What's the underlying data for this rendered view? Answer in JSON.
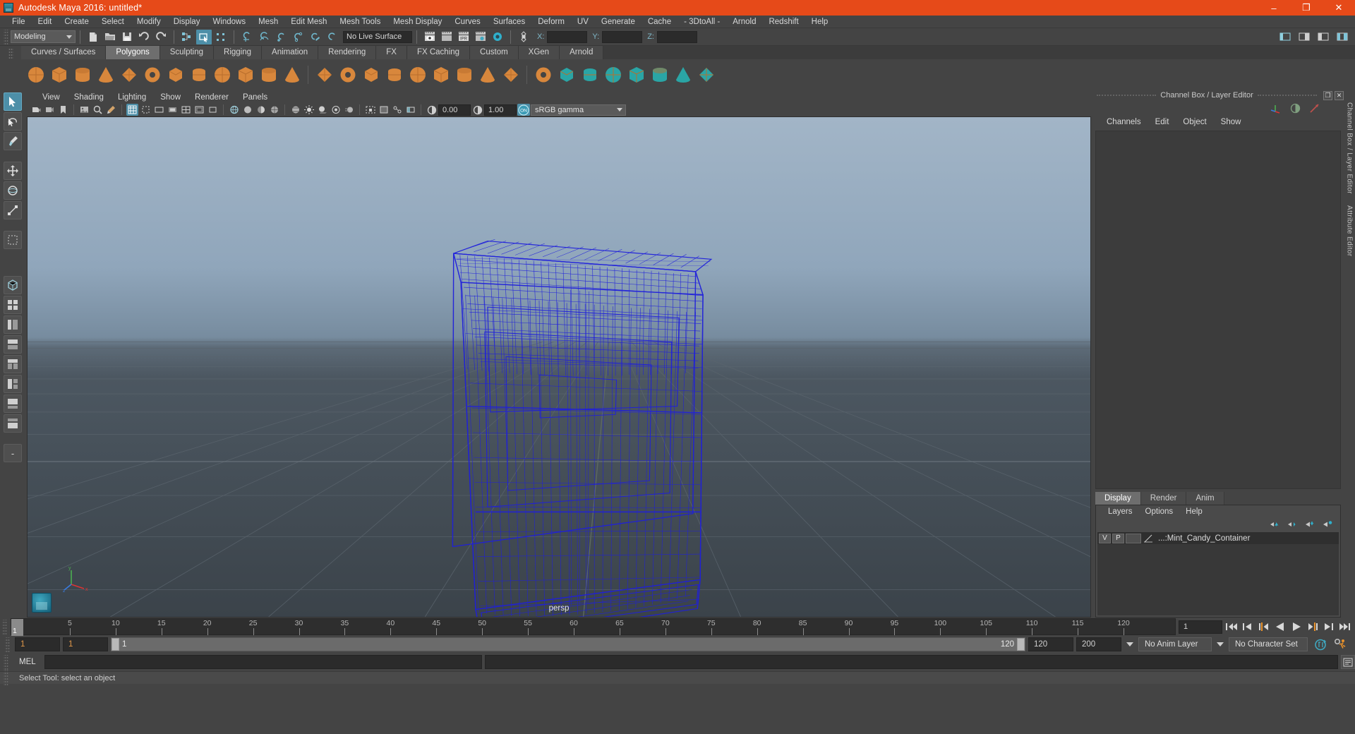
{
  "window": {
    "title": "Autodesk Maya 2016: untitled*",
    "icon": "maya-logo-icon",
    "minimize": "–",
    "maximize": "❐",
    "close": "✕",
    "titlebar_color": "#E64A19"
  },
  "menubar": {
    "items": [
      "File",
      "Edit",
      "Create",
      "Select",
      "Modify",
      "Display",
      "Windows",
      "Mesh",
      "Edit Mesh",
      "Mesh Tools",
      "Mesh Display",
      "Curves",
      "Surfaces",
      "Deform",
      "UV",
      "Generate",
      "Cache",
      "- 3DtoAll -",
      "Arnold",
      "Redshift",
      "Help"
    ]
  },
  "statusbar": {
    "mode_menu": "Modeling",
    "live_surface": "No Live Surface",
    "axis": {
      "x_label": "X:",
      "x_value": "",
      "y_label": "Y:",
      "y_value": "",
      "z_label": "Z:",
      "z_value": ""
    },
    "icons": [
      "new-scene-icon",
      "open-scene-icon",
      "save-scene-icon",
      "undo-icon",
      "redo-icon",
      "select-by-hierarchy-icon",
      "select-by-object-icon",
      "select-by-component-icon",
      "snap-to-grid-icon",
      "snap-to-curve-icon",
      "snap-to-point-icon",
      "snap-to-projected-center-icon",
      "snap-to-view-plane-icon",
      "make-live-icon",
      "render-current-frame-icon",
      "render-sequence-icon",
      "ipr-render-icon",
      "render-settings-icon",
      "hypershade-icon",
      "toggle-editors-icon"
    ]
  },
  "shelf": {
    "tabs": [
      "Curves / Surfaces",
      "Polygons",
      "Sculpting",
      "Rigging",
      "Animation",
      "Rendering",
      "FX",
      "FX Caching",
      "Custom",
      "XGen",
      "Arnold"
    ],
    "selected_tab": "Polygons",
    "icons": [
      "poly-sphere-icon",
      "poly-cube-icon",
      "poly-cylinder-icon",
      "poly-cone-icon",
      "poly-plane-icon",
      "poly-torus-icon",
      "poly-prism-icon",
      "poly-pyramid-icon",
      "poly-pipe-icon",
      "poly-helix-icon",
      "poly-soccer-ball-icon",
      "poly-platonic-icon",
      "poly-combine-icon",
      "poly-separate-icon",
      "poly-smooth-icon",
      "poly-extrude-icon",
      "poly-bevel-icon",
      "poly-bridge-icon",
      "poly-append-icon",
      "poly-wedge-icon",
      "poly-duplicate-icon",
      "poly-booleans-union-icon",
      "poly-booleans-difference-icon",
      "poly-booleans-intersection-icon",
      "poly-mirror-icon",
      "poly-reduce-icon",
      "poly-triangulate-icon",
      "poly-quadrangulate-icon",
      "poly-crease-icon"
    ]
  },
  "toolbox": {
    "items": [
      "select-tool",
      "lasso-select-tool",
      "paint-select-tool",
      "move-tool",
      "rotate-tool",
      "scale-tool",
      "last-tool",
      "show-manipulator-tool"
    ],
    "layout_icons": [
      "single-perspective-view",
      "four-view-layout",
      "persp-outliner-layout",
      "persp-graph-layout",
      "persp-hypershade-layout",
      "two-panes-stacked",
      "persp-uv-layout",
      "persp-relationship-layout",
      "more-layouts"
    ],
    "selected": "select-tool"
  },
  "viewport": {
    "menus": [
      "View",
      "Shading",
      "Lighting",
      "Show",
      "Renderer",
      "Panels"
    ],
    "camera_label": "persp",
    "toolbar": {
      "exposure_value": "0.00",
      "gamma_value": "1.00",
      "color_management_toggle": "ON",
      "view_transform": "sRGB gamma"
    },
    "axis_gizmo": {
      "y": "y",
      "x": "x",
      "z": "z"
    },
    "object_name": "Mint_Candy_Container",
    "wireframe_color": "#1b1bd8"
  },
  "right_dock": {
    "panel_title": "Channel Box / Layer Editor",
    "restore_btn": "❐",
    "close_btn": "✕",
    "menus": [
      "Channels",
      "Edit",
      "Object",
      "Show"
    ],
    "side_tabs": [
      "Channel Box / Layer Editor",
      "Attribute Editor"
    ],
    "header_icons": [
      "channel-box-icon",
      "attribute-editor-icon",
      "modeling-toolkit-icon"
    ],
    "layer_tabs": [
      "Display",
      "Render",
      "Anim"
    ],
    "selected_layer_tab": "Display",
    "layer_menus": [
      "Layers",
      "Options",
      "Help"
    ],
    "layer_toolbar_icons": [
      "move-layer-up-icon",
      "move-layer-down-icon",
      "new-layer-icon",
      "new-layer-from-selected-icon"
    ],
    "layers": [
      {
        "visibility": "V",
        "playback": "P",
        "color": "",
        "name": "...:Mint_Candy_Container"
      }
    ]
  },
  "timeline": {
    "ticks": [
      5,
      10,
      15,
      20,
      25,
      30,
      35,
      40,
      45,
      50,
      55,
      60,
      65,
      70,
      75,
      80,
      85,
      90,
      95,
      100,
      105,
      110,
      115,
      120
    ],
    "current_frame_marker": "1",
    "end_label": "120",
    "current_frame_field": "1",
    "playback_buttons": [
      "go-to-start-icon",
      "step-back-frame-icon",
      "step-back-key-icon",
      "play-backwards-icon",
      "play-forwards-icon",
      "step-forward-key-icon",
      "step-forward-frame-icon",
      "go-to-end-icon"
    ]
  },
  "range_slider": {
    "anim_start": "1",
    "range_start": "1",
    "slider_start_label": "1",
    "slider_end_label": "120",
    "range_end": "120",
    "anim_end": "200",
    "anim_layer": "No Anim Layer",
    "character_set": "No Character Set",
    "auto_key_icon": "auto-keyframe-icon",
    "anim_prefs_icon": "animation-preferences-icon"
  },
  "command_line": {
    "language_label": "MEL",
    "input_value": "",
    "output_value": "",
    "script_editor_icon": "script-editor-icon"
  },
  "status_line": {
    "message": "Select Tool: select an object"
  }
}
